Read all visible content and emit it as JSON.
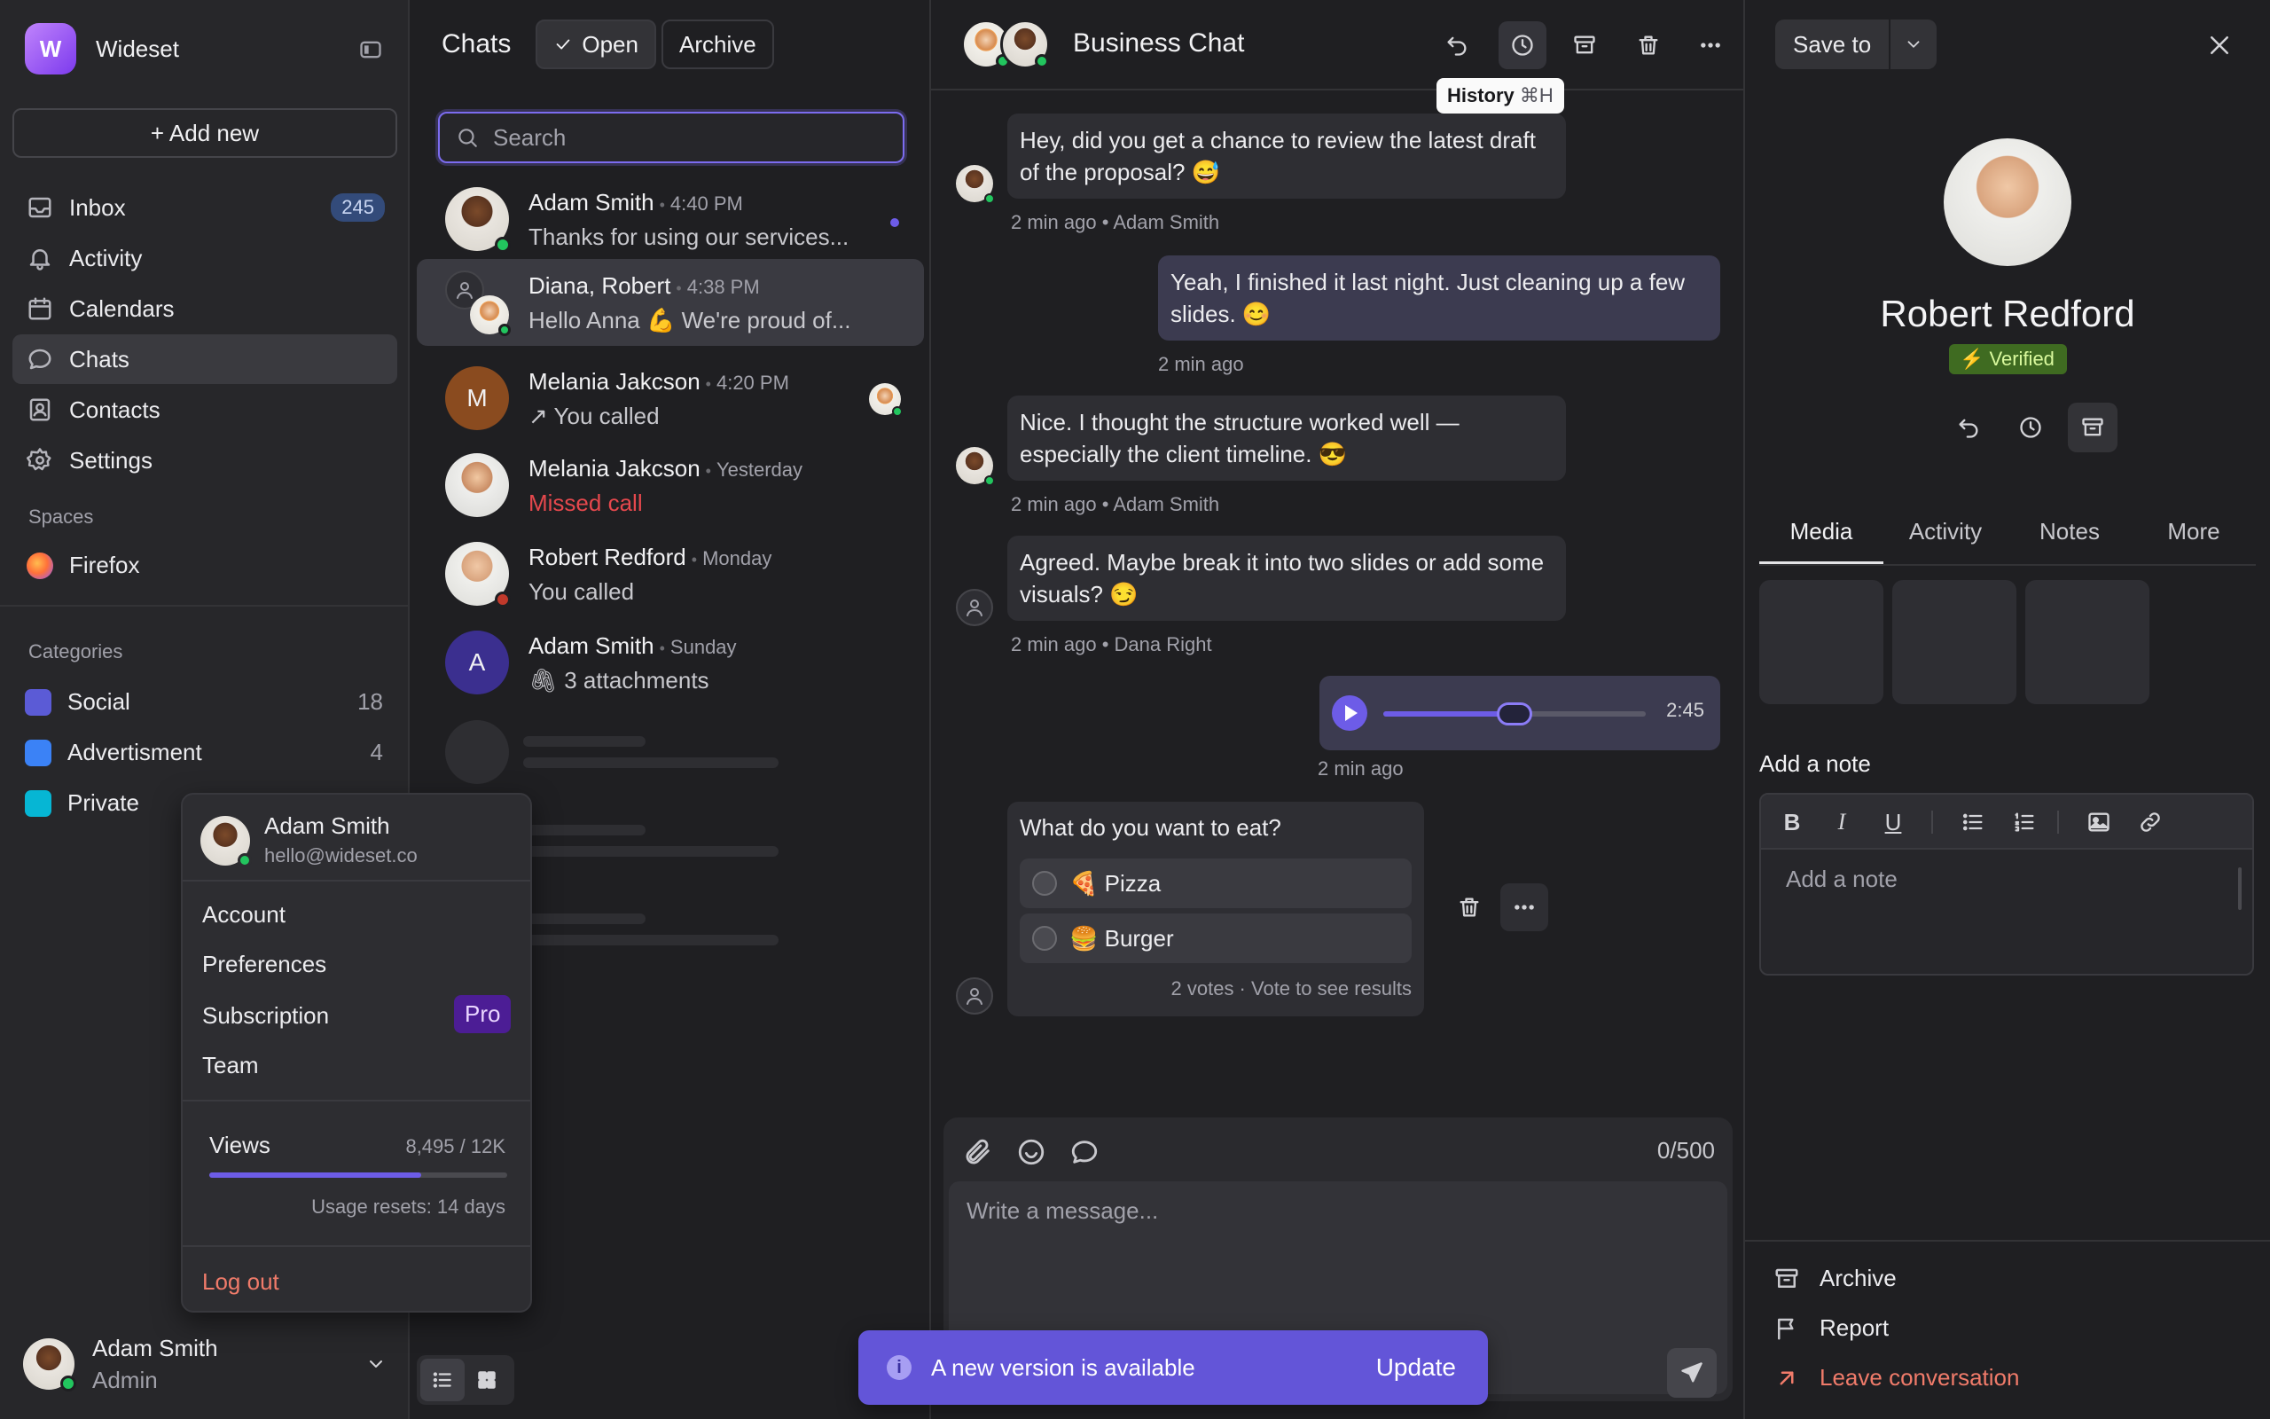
{
  "sidebar": {
    "brand": "Wideset",
    "add_new": "+ Add new",
    "nav": [
      {
        "label": "Inbox",
        "icon": "inbox-icon",
        "badge": "245"
      },
      {
        "label": "Activity",
        "icon": "bell-icon"
      },
      {
        "label": "Calendars",
        "icon": "calendar-icon"
      },
      {
        "label": "Chats",
        "icon": "chat-icon",
        "active": true
      },
      {
        "label": "Contacts",
        "icon": "contacts-icon"
      },
      {
        "label": "Settings",
        "icon": "gear-icon"
      }
    ],
    "spaces_label": "Spaces",
    "spaces": [
      {
        "label": "Firefox",
        "icon": "firefox-icon"
      }
    ],
    "categories_label": "Categories",
    "categories": [
      {
        "label": "Social",
        "count": "18",
        "color": "#5b5bd6"
      },
      {
        "label": "Advertisment",
        "count": "4",
        "color": "#3b82f6"
      },
      {
        "label": "Private",
        "count": "",
        "color": "#06b6d4"
      }
    ],
    "profile": {
      "name": "Adam Smith",
      "role": "Admin"
    }
  },
  "user_menu": {
    "name": "Adam Smith",
    "email": "hello@wideset.co",
    "items": [
      "Account",
      "Preferences",
      "Subscription",
      "Team"
    ],
    "pro_badge": "Pro",
    "views_label": "Views",
    "views_value": "8,495 / 12K",
    "views_progress": 0.71,
    "usage_reset": "Usage resets: 14 days",
    "logout": "Log out"
  },
  "chat_list": {
    "title": "Chats",
    "filter_open": "Open",
    "filter_archive": "Archive",
    "search_placeholder": "Search",
    "chats": [
      {
        "name": "Adam Smith",
        "time": "4:40 PM",
        "preview": "Thanks for using our services...",
        "unread": true
      },
      {
        "name": "Diana, Robert",
        "time": "4:38 PM",
        "preview": "Hello Anna 💪 We're proud of..."
      },
      {
        "name": "Melania Jakcson",
        "time": "4:20 PM",
        "preview": "You called",
        "initial": "M"
      },
      {
        "name": "Melania Jakcson",
        "time": "Yesterday",
        "preview": "Missed call"
      },
      {
        "name": "Robert Redford",
        "time": "Monday",
        "preview": "You called"
      },
      {
        "name": "Adam Smith",
        "time": "Sunday",
        "preview": "3 attachments",
        "initial": "A"
      }
    ]
  },
  "conversation": {
    "title": "Business Chat",
    "tooltip": "History",
    "tooltip_kbd": "⌘H",
    "messages": [
      {
        "text": "Hey, did you get a chance to review the latest draft of the proposal? 😅",
        "meta": "2 min ago • Adam Smith"
      },
      {
        "text": "Yeah, I finished it last night. Just cleaning up a few slides. 😊",
        "meta": "2 min ago"
      },
      {
        "text": "Nice. I thought the structure worked well — especially the client timeline. 😎",
        "meta": "2 min ago • Adam Smith"
      },
      {
        "text": "Agreed. Maybe break it into two slides or add some visuals? 😏",
        "meta": "2 min ago • Dana Right"
      }
    ],
    "audio": {
      "duration": "2:45",
      "meta": "2 min ago",
      "progress": 0.5
    },
    "poll": {
      "question": "What do you want to eat?",
      "options": [
        "🍕 Pizza",
        "🍔 Burger"
      ],
      "footer": "2 votes · Vote to see results"
    },
    "composer": {
      "count": "0/500",
      "placeholder": "Write a message..."
    },
    "toast": {
      "text": "A new version is available",
      "action": "Update"
    }
  },
  "details": {
    "save_to": "Save to",
    "name": "Robert Redford",
    "verified": "Verified",
    "tabs": [
      "Media",
      "Activity",
      "Notes",
      "More"
    ],
    "add_note_label": "Add a note",
    "note_placeholder": "Add a note",
    "footer": [
      "Archive",
      "Report",
      "Leave conversation"
    ]
  }
}
